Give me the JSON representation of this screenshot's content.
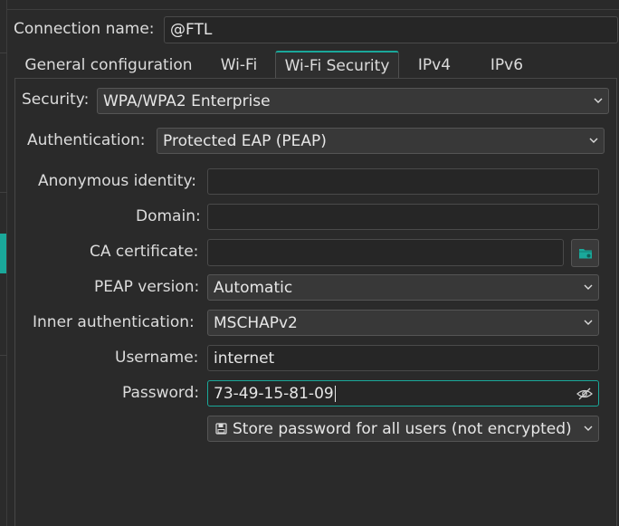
{
  "connection": {
    "name_label": "Connection name:",
    "name_value": "@FTL"
  },
  "tabs": [
    {
      "label": "General configuration"
    },
    {
      "label": "Wi-Fi"
    },
    {
      "label": "Wi-Fi Security"
    },
    {
      "label": "IPv4"
    },
    {
      "label": "IPv6"
    }
  ],
  "active_tab": "Wi-Fi Security",
  "security": {
    "label": "Security:",
    "value": "WPA/WPA2 Enterprise"
  },
  "authentication": {
    "label": "Authentication:",
    "value": "Protected EAP (PEAP)"
  },
  "anonymous_identity": {
    "label": "Anonymous identity:",
    "value": ""
  },
  "domain": {
    "label": "Domain:",
    "value": ""
  },
  "ca_certificate": {
    "label": "CA certificate:",
    "value": ""
  },
  "peap_version": {
    "label": "PEAP version:",
    "value": "Automatic"
  },
  "inner_authentication": {
    "label": "Inner authentication:",
    "value": "MSCHAPv2"
  },
  "username": {
    "label": "Username:",
    "value": "internet"
  },
  "password": {
    "label": "Password:",
    "value": "73-49-15-81-09"
  },
  "password_storage": {
    "value": "Store password for all users (not encrypted)"
  },
  "icons": {
    "folder": "folder-open-icon",
    "eye": "eye-slash-icon",
    "chevron": "chevron-down-icon",
    "storage": "floppy-disk-icon"
  },
  "colors": {
    "accent": "#1aa89a",
    "background": "#2a2a2a",
    "text": "#dcdcdc"
  }
}
